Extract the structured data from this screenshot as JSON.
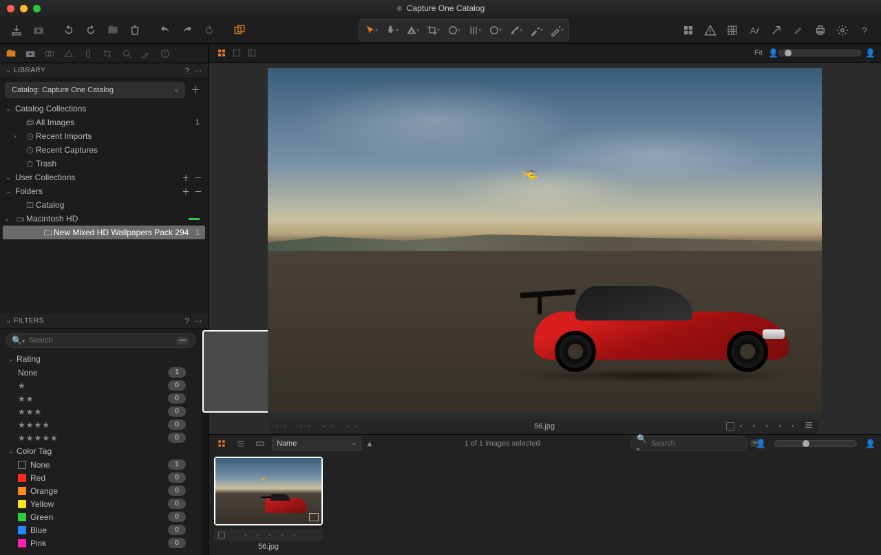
{
  "window": {
    "title": "Capture One Catalog"
  },
  "sidebar": {
    "library": {
      "title": "LIBRARY",
      "catalog_select": "Catalog: Capture One Catalog",
      "sections": {
        "catalog_collections": "Catalog Collections",
        "all_images": {
          "label": "All Images",
          "count": "1"
        },
        "recent_imports": "Recent Imports",
        "recent_captures": "Recent Captures",
        "trash": "Trash",
        "user_collections": "User Collections",
        "folders": "Folders",
        "catalog": "Catalog",
        "drive": "Macintosh HD",
        "subfolder": {
          "label": "New Mixed HD Wallpapers Pack 294",
          "count": "1"
        }
      }
    },
    "filters": {
      "title": "FILTERS",
      "search_placeholder": "Search",
      "rating_header": "Rating",
      "rating_none": {
        "label": "None",
        "count": "1"
      },
      "stars": [
        {
          "stars": "★",
          "count": "0"
        },
        {
          "stars": "★★",
          "count": "0"
        },
        {
          "stars": "★★★",
          "count": "0"
        },
        {
          "stars": "★★★★",
          "count": "0"
        },
        {
          "stars": "★★★★★",
          "count": "0"
        }
      ],
      "color_header": "Color Tag",
      "colors": [
        {
          "label": "None",
          "hex": "transparent",
          "count": "1"
        },
        {
          "label": "Red",
          "hex": "#ff2a1f",
          "count": "0"
        },
        {
          "label": "Orange",
          "hex": "#ff8a1f",
          "count": "0"
        },
        {
          "label": "Yellow",
          "hex": "#ffe01f",
          "count": "0"
        },
        {
          "label": "Green",
          "hex": "#2ecc40",
          "count": "0"
        },
        {
          "label": "Blue",
          "hex": "#1f8aff",
          "count": "0"
        },
        {
          "label": "Pink",
          "hex": "#ff1fb4",
          "count": "0"
        }
      ]
    }
  },
  "viewer": {
    "fit_label": "Fit",
    "info_dashes": "--   --   --   --",
    "filename": "56.jpg",
    "sort_by": "Name",
    "selection_status": "1 of 1 images selected",
    "search_placeholder": "Search",
    "thumb_filename": "56.jpg"
  }
}
